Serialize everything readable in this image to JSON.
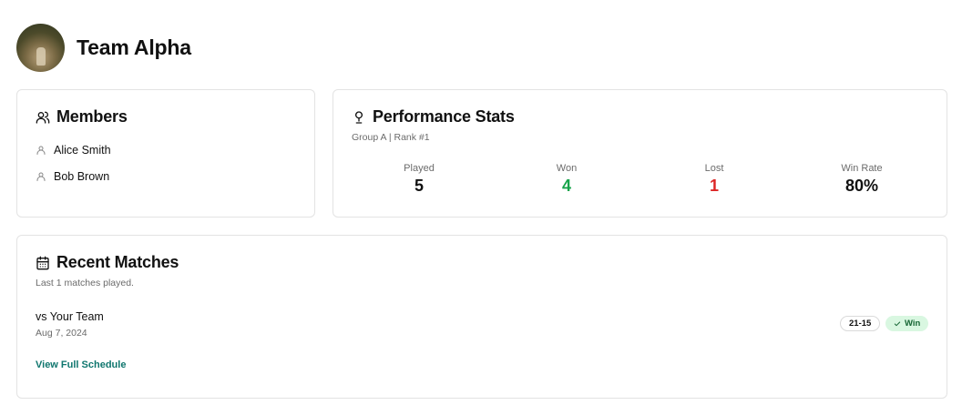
{
  "team": {
    "name": "Team Alpha"
  },
  "members": {
    "title": "Members",
    "items": [
      "Alice Smith",
      "Bob Brown"
    ]
  },
  "stats": {
    "title": "Performance Stats",
    "subtitle": "Group A | Rank #1",
    "played": {
      "label": "Played",
      "value": "5"
    },
    "won": {
      "label": "Won",
      "value": "4",
      "color": "#16a34a"
    },
    "lost": {
      "label": "Lost",
      "value": "1",
      "color": "#dc2626"
    },
    "win_rate": {
      "label": "Win Rate",
      "value": "80%"
    }
  },
  "matches": {
    "title": "Recent Matches",
    "subtitle": "Last 1 matches played.",
    "items": [
      {
        "opponent": "vs Your Team",
        "date": "Aug 7, 2024",
        "score": "21-15",
        "result": "Win"
      }
    ],
    "link": "View Full Schedule"
  },
  "icons": {
    "members": "users-icon",
    "member": "user-icon",
    "stats": "trophy-icon",
    "matches": "calendar-icon",
    "result": "check-icon"
  },
  "colors": {
    "link": "#0f766e",
    "win_badge_bg": "#d9f7e1",
    "win_badge_text": "#166534"
  }
}
